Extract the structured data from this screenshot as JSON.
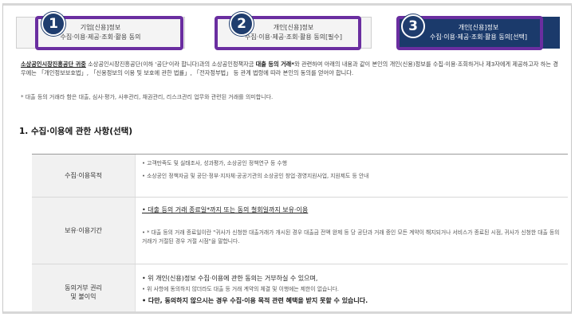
{
  "tabs": [
    {
      "line1": "기업[신용]정보",
      "line2": "수집·이용·제공·조회·활용 동의",
      "badge": "1"
    },
    {
      "line1": "개인[신용]정보",
      "line2": "수집·이용·제공·조회·활용 동의[필수]",
      "badge": "2"
    },
    {
      "line1": "개인[신용]정보",
      "line2": "수집·이용·제공·조회·활용 동의[선택]",
      "badge": "3"
    }
  ],
  "intro": {
    "org": "소상공인시장진흥공단 귀중",
    "text1": " 소상공인시장진흥공단(이하 '공단'이라 합니다)과의 소상공인정책자금 ",
    "bold1": "대출 등의 거래*",
    "text2": "와 관련하여 아래의 내용과 같이 본인의 개인(신용)정보를 수집·이용·조회하거나 제3자에게 제공하고자 하는 경우에는 「개인정보보호법」, 「신용정보의 이용 및 보호에 관한 법률」, 「전자정부법」 등 관계 법령에 따라 본인의 동의를 얻어야 합니다."
  },
  "note": "* 대출 등의 거래라 함은 대출, 심사·평가, 사후관리, 채권관리, 리스크관리 업무와 관련된 거래를 의미합니다.",
  "section_title": "1. 수집·이용에 관한 사항(선택)",
  "rows": [
    {
      "header": "수집·이용목적",
      "lines": [
        "• 고객만족도 및 실태조사, 성과평가, 소상공인 정책연구 등 수행",
        "• 소상공인 정책자금 및 공단·정부·지자체·공공기관의 소상공인 창업·경영지원사업, 지원제도 등 안내"
      ]
    },
    {
      "header": "보유·이용기간",
      "main": "• 대출 등의 거래 종료일*까지 또는 동의 철회일까지 보유·이용",
      "sub": "• * 대출 등의 거래 종료일이란 \"귀사가 신청한 대출거래가 개시된 경우 대출금 전액 완제 등 당 공단과 거래 중인 모든 계약이 해지되거나 서비스가 종료된 시점, 귀사가 신청한 대출 등의 거래가 거절된 경우 거절 시점\"을 말합니다."
    },
    {
      "header": "동의거부 권리\n및 불이익",
      "l1": "• 위 개인(신용)정보 수집·이용에 관한 동의는 거부하실 수 있으며,",
      "l2": "• 위 사항에 동의하지 않더라도 대출 등 거래 계약의 체결 및 이행에는 제한이 없습니다.",
      "l3": "• 다만, 동의하지 않으시는 경우 수집·이용 목적 관련 혜택을 받지 못할 수 있습니다."
    }
  ],
  "colors": {
    "active_tab": "#1b3a6b",
    "highlight": "#6a2ea0",
    "badge": "#1f3d6e"
  }
}
